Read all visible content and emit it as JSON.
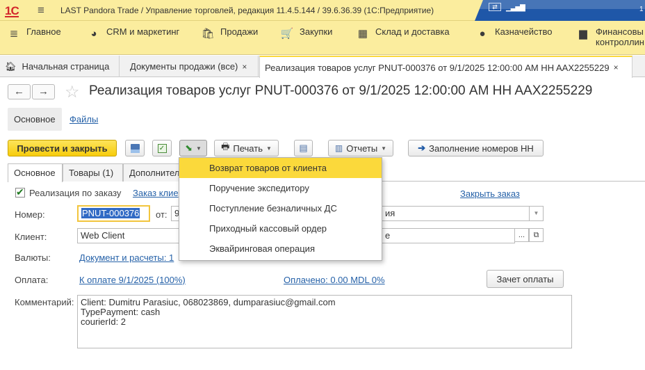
{
  "app": {
    "logo": "1С",
    "title": "LAST Pandora Trade / Управление торговлей, редакция 11.4.5.144 / 39.6.36.39  (1С:Предприятие)",
    "clock": "1"
  },
  "menu": {
    "items": [
      {
        "label": "Главное",
        "icon": "menu-lines-icon"
      },
      {
        "label": "CRM и маркетинг",
        "icon": "pie-chart-icon"
      },
      {
        "label": "Продажи",
        "icon": "shopping-bag-icon"
      },
      {
        "label": "Закупки",
        "icon": "cart-icon"
      },
      {
        "label": "Склад и доставка",
        "icon": "warehouse-icon"
      },
      {
        "label": "Казначейство",
        "icon": "ruble-coin-icon"
      },
      {
        "label_line1": "Финансовы",
        "label_line2": "контроллин",
        "icon": "bar-chart-icon"
      }
    ]
  },
  "tabs": [
    {
      "label": "Начальная страница",
      "icon": "home-icon"
    },
    {
      "label": "Документы продажи (все)",
      "close": "×"
    },
    {
      "label": "Реализация товаров услуг PNUT-000376 от 9/1/2025 12:00:00 AM HH AAX2255229",
      "close": "×"
    }
  ],
  "header": {
    "back": "←",
    "forward": "→",
    "star": "☆",
    "title": "Реализация товаров услуг PNUT-000376 от 9/1/2025 12:00:00 AM HH AAX2255229",
    "subnav_main": "Основное",
    "subnav_files": "Файлы"
  },
  "toolbar": {
    "post_close": "Провести и закрыть",
    "print": "Печать",
    "reports": "Отчеты",
    "fill_numbers": "Заполнение номеров НН"
  },
  "create_on_basis_menu": [
    "Возврат товаров от клиента",
    "Поручение экспедитору",
    "Поступление безналичных ДС",
    "Приходный кассовый ордер",
    "Эквайринговая операция"
  ],
  "inner_tabs": [
    "Основное",
    "Товары (1)",
    "Дополнител"
  ],
  "form": {
    "by_order_label": "Реализация по заказу",
    "client_order_link": "Заказ клие",
    "close_order_link": "Закрыть заказ",
    "number_label": "Номер:",
    "number_value": "PNUT-000376",
    "from_label": "от:",
    "from_value": "9",
    "right_field1_value": "ия",
    "client_label": "Клиент:",
    "client_value": "Web Client",
    "right_field2_value": "е",
    "ellipsis": "...",
    "currency_label": "Валюты:",
    "currency_link": "Документ и расчеты: 1",
    "payment_label": "Оплата:",
    "payment_link": "К оплате 9/1/2025 (100%)",
    "paid_link": "Оплачено: 0.00 MDL  0%",
    "offset_button": "Зачет оплаты",
    "comment_label": "Комментарий:",
    "comment_lines": [
      "Client: Dumitru Parasiuc, 068023869, dumparasiuc@gmail.com",
      "TypePayment: cash",
      "courierId: 2"
    ]
  },
  "colors": {
    "menu_bg": "#fbed9e",
    "primary_button": "#f7cc0c",
    "highlight": "#fbd93b",
    "link": "#2561a8"
  }
}
